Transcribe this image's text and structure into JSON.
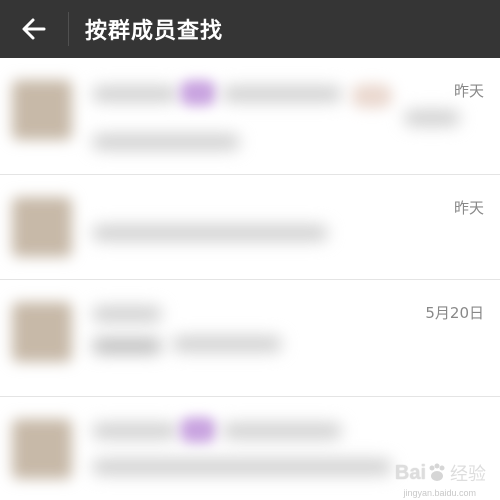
{
  "header": {
    "title": "按群成员查找",
    "back_icon": "arrow-left-icon",
    "background": "#353535"
  },
  "list": {
    "items": [
      {
        "time": "昨天"
      },
      {
        "time": "昨天"
      },
      {
        "time": "5月20日"
      },
      {
        "time": ""
      }
    ]
  },
  "watermark": {
    "brand": "Bai",
    "brand_sub": "经验",
    "url": "jingyan.baidu.com"
  }
}
